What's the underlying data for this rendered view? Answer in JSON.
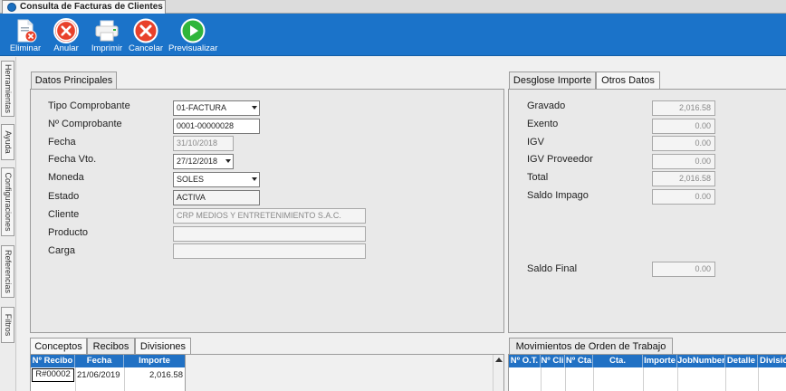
{
  "window": {
    "title": "Consulta de Facturas de Clientes"
  },
  "toolbar": {
    "eliminar": "Eliminar",
    "anular": "Anular",
    "imprimir": "Imprimir",
    "cancelar": "Cancelar",
    "previsualizar": "Previsualizar"
  },
  "sidebar": {
    "tabs": [
      "Herramientas",
      "Ayuda",
      "Configuraciones",
      "Referencias",
      "Filtros"
    ]
  },
  "datos_principales": {
    "tab": "Datos Principales",
    "labels": {
      "tipo": "Tipo Comprobante",
      "numero": "Nº Comprobante",
      "fecha": "Fecha",
      "fecha_vto": "Fecha Vto.",
      "moneda": "Moneda",
      "estado": "Estado",
      "cliente": "Cliente",
      "producto": "Producto",
      "carga": "Carga"
    },
    "values": {
      "tipo": "01-FACTURA",
      "numero": "0001-00000028",
      "fecha": "31/10/2018",
      "fecha_vto": "27/12/2018",
      "moneda": "SOLES",
      "estado": "ACTIVA",
      "cliente": "CRP MEDIOS Y ENTRETENIMIENTO S.A.C.",
      "producto": "",
      "carga": ""
    }
  },
  "desglose": {
    "tabs": [
      "Desglose Importe",
      "Otros Datos"
    ],
    "labels": {
      "gravado": "Gravado",
      "exento": "Exento",
      "igv": "IGV",
      "igv_proveedor": "IGV Proveedor",
      "total": "Total",
      "saldo_impago": "Saldo Impago",
      "saldo_final": "Saldo Final"
    },
    "values": {
      "gravado": "2,016.58",
      "exento": "0.00",
      "igv": "0.00",
      "igv_proveedor": "0.00",
      "total": "2,016.58",
      "saldo_impago": "0.00",
      "saldo_final": "0.00"
    }
  },
  "lower_left": {
    "tabs": [
      "Conceptos",
      "Recibos",
      "Divisiones"
    ],
    "columns": [
      "Nº Recibo",
      "Fecha",
      "Importe"
    ],
    "rows": [
      {
        "recibo": "R#00002",
        "fecha": "21/06/2019",
        "importe": "2,016.58"
      }
    ]
  },
  "lower_right": {
    "tab": "Movimientos de Orden de Trabajo",
    "columns": [
      "Nº O.T.",
      "Nº Cli",
      "Nº Cta",
      "Cta.",
      "Importe",
      "JobNumber",
      "Detalle",
      "División"
    ]
  }
}
